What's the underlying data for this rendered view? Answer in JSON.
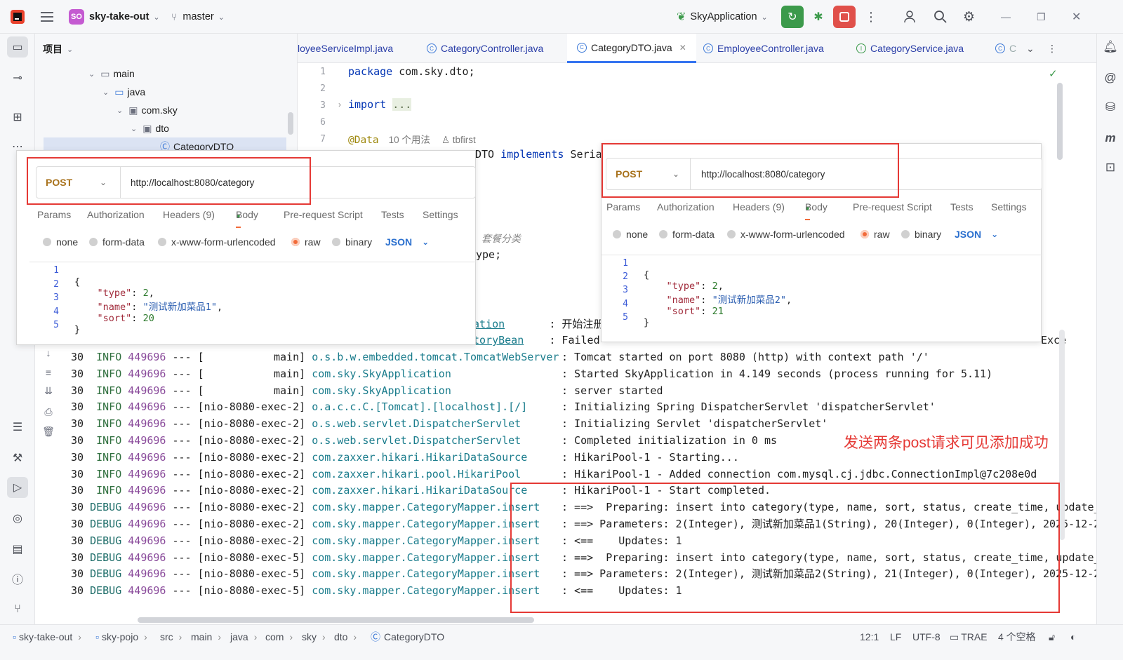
{
  "titlebar": {
    "project_badge": "SO",
    "project_name": "sky-take-out",
    "branch": "master",
    "run_config": "SkyApplication"
  },
  "project_panel": {
    "title": "项目",
    "tree": [
      {
        "label": "main"
      },
      {
        "label": "java"
      },
      {
        "label": "com.sky"
      },
      {
        "label": "dto"
      },
      {
        "label": "CategoryDTO"
      }
    ]
  },
  "editor_tabs": [
    {
      "label": "loyeeServiceImpl.java"
    },
    {
      "label": "CategoryController.java"
    },
    {
      "label": "CategoryDTO.java"
    },
    {
      "label": "EmployeeController.java"
    },
    {
      "label": "CategoryService.java"
    },
    {
      "label": "C"
    }
  ],
  "editor": {
    "line_numbers": [
      "1",
      "2",
      "3",
      "6",
      "7"
    ],
    "line1_kw": "package",
    "line1_rest": " com.sky.dto;",
    "line3_kw": "import",
    "line3_fold": "...",
    "line7_ann": "@Data",
    "line7_usages": "10 个用法",
    "line7_author": "tbfirst",
    "line8_rest": "DTO ",
    "line8_kw": "implements",
    "line8_tail": " Serial",
    "comment_fragment": "套餐分类",
    "type_fragment": "ype;"
  },
  "postman_left": {
    "method": "POST",
    "url": "http://localhost:8080/category",
    "tabs": [
      "Params",
      "Authorization",
      "Headers (9)",
      "Body",
      "Pre-request Script",
      "Tests",
      "Settings"
    ],
    "body_modes": [
      "none",
      "form-data",
      "x-www-form-urlencoded",
      "raw",
      "binary"
    ],
    "format": "JSON",
    "line_numbers": [
      "1",
      "2",
      "3",
      "4",
      "5"
    ],
    "json": {
      "open": "{",
      "type_key": "\"type\"",
      "type_val": "2",
      "name_key": "\"name\"",
      "name_val": "\"测试新加菜品1\"",
      "sort_key": "\"sort\"",
      "sort_val": "20",
      "close": "}"
    }
  },
  "postman_right": {
    "method": "POST",
    "url": "http://localhost:8080/category",
    "tabs": [
      "Params",
      "Authorization",
      "Headers (9)",
      "Body",
      "Pre-request Script",
      "Tests",
      "Settings"
    ],
    "body_modes": [
      "none",
      "form-data",
      "x-www-form-urlencoded",
      "raw",
      "binary"
    ],
    "format": "JSON",
    "line_numbers": [
      "1",
      "2",
      "3",
      "4",
      "5"
    ],
    "json": {
      "open": "{",
      "type_key": "\"type\"",
      "type_val": "2",
      "name_key": "\"name\"",
      "name_val": "\"测试新加菜品2\"",
      "sort_key": "\"sort\"",
      "sort_val": "21",
      "close": "}"
    }
  },
  "console": {
    "partial_top": [
      {
        "logger": "ation",
        "msg": ": 开始注册"
      },
      {
        "logger": "toryBean",
        "msg": ": Failed"
      }
    ],
    "partial_right": "Exce",
    "rows": [
      {
        "ts": "30",
        "level": "INFO",
        "pid": "449696",
        "sep": "---",
        "thread": "[           main]",
        "logger": "o.s.b.w.embedded.tomcat.TomcatWebServer",
        "msg": ": Tomcat started on port 8080 (http) with context path '/'"
      },
      {
        "ts": "30",
        "level": "INFO",
        "pid": "449696",
        "sep": "---",
        "thread": "[           main]",
        "logger": "com.sky.SkyApplication",
        "msg": ": Started SkyApplication in 4.149 seconds (process running for 5.11)"
      },
      {
        "ts": "30",
        "level": "INFO",
        "pid": "449696",
        "sep": "---",
        "thread": "[           main]",
        "logger": "com.sky.SkyApplication",
        "msg": ": server started"
      },
      {
        "ts": "30",
        "level": "INFO",
        "pid": "449696",
        "sep": "---",
        "thread": "[nio-8080-exec-2]",
        "logger": "o.a.c.c.C.[Tomcat].[localhost].[/]",
        "msg": ": Initializing Spring DispatcherServlet 'dispatcherServlet'"
      },
      {
        "ts": "30",
        "level": "INFO",
        "pid": "449696",
        "sep": "---",
        "thread": "[nio-8080-exec-2]",
        "logger": "o.s.web.servlet.DispatcherServlet",
        "msg": ": Initializing Servlet 'dispatcherServlet'"
      },
      {
        "ts": "30",
        "level": "INFO",
        "pid": "449696",
        "sep": "---",
        "thread": "[nio-8080-exec-2]",
        "logger": "o.s.web.servlet.DispatcherServlet",
        "msg": ": Completed initialization in 0 ms"
      },
      {
        "ts": "30",
        "level": "INFO",
        "pid": "449696",
        "sep": "---",
        "thread": "[nio-8080-exec-2]",
        "logger": "com.zaxxer.hikari.HikariDataSource",
        "msg": ": HikariPool-1 - Starting..."
      },
      {
        "ts": "30",
        "level": "INFO",
        "pid": "449696",
        "sep": "---",
        "thread": "[nio-8080-exec-2]",
        "logger": "com.zaxxer.hikari.pool.HikariPool",
        "msg": ": HikariPool-1 - Added connection com.mysql.cj.jdbc.ConnectionImpl@7c208e0d"
      },
      {
        "ts": "30",
        "level": "INFO",
        "pid": "449696",
        "sep": "---",
        "thread": "[nio-8080-exec-2]",
        "logger": "com.zaxxer.hikari.HikariDataSource",
        "msg": ": HikariPool-1 - Start completed."
      },
      {
        "ts": "30",
        "level": "DEBUG",
        "pid": "449696",
        "sep": "---",
        "thread": "[nio-8080-exec-2]",
        "logger": "com.sky.mapper.CategoryMapper.insert",
        "msg": ": ==>  Preparing: insert into category(type, name, sort, status, create_time, update_"
      },
      {
        "ts": "30",
        "level": "DEBUG",
        "pid": "449696",
        "sep": "---",
        "thread": "[nio-8080-exec-2]",
        "logger": "com.sky.mapper.CategoryMapper.insert",
        "msg": ": ==> Parameters: 2(Integer), 测试新加菜品1(String), 20(Integer), 0(Integer), 2025-12-2"
      },
      {
        "ts": "30",
        "level": "DEBUG",
        "pid": "449696",
        "sep": "---",
        "thread": "[nio-8080-exec-2]",
        "logger": "com.sky.mapper.CategoryMapper.insert",
        "msg": ": <==    Updates: 1"
      },
      {
        "ts": "30",
        "level": "DEBUG",
        "pid": "449696",
        "sep": "---",
        "thread": "[nio-8080-exec-5]",
        "logger": "com.sky.mapper.CategoryMapper.insert",
        "msg": ": ==>  Preparing: insert into category(type, name, sort, status, create_time, update_"
      },
      {
        "ts": "30",
        "level": "DEBUG",
        "pid": "449696",
        "sep": "---",
        "thread": "[nio-8080-exec-5]",
        "logger": "com.sky.mapper.CategoryMapper.insert",
        "msg": ": ==> Parameters: 2(Integer), 测试新加菜品2(String), 21(Integer), 0(Integer), 2025-12-2"
      },
      {
        "ts": "30",
        "level": "DEBUG",
        "pid": "449696",
        "sep": "---",
        "thread": "[nio-8080-exec-5]",
        "logger": "com.sky.mapper.CategoryMapper.insert",
        "msg": ": <==    Updates: 1"
      }
    ]
  },
  "annotation_text": "发送两条post请求可见添加成功",
  "breadcrumb": [
    "sky-take-out",
    "sky-pojo",
    "src",
    "main",
    "java",
    "com",
    "sky",
    "dto",
    "CategoryDTO"
  ],
  "status": {
    "position": "12:1",
    "line_sep": "LF",
    "encoding": "UTF-8",
    "plugin": "TRAE",
    "indent": "4 个空格"
  },
  "colors": {
    "accent_red": "#e53935",
    "run_green": "#3c9a4b",
    "stop_red": "#e0504a",
    "postman_orange": "#f26b3a"
  }
}
